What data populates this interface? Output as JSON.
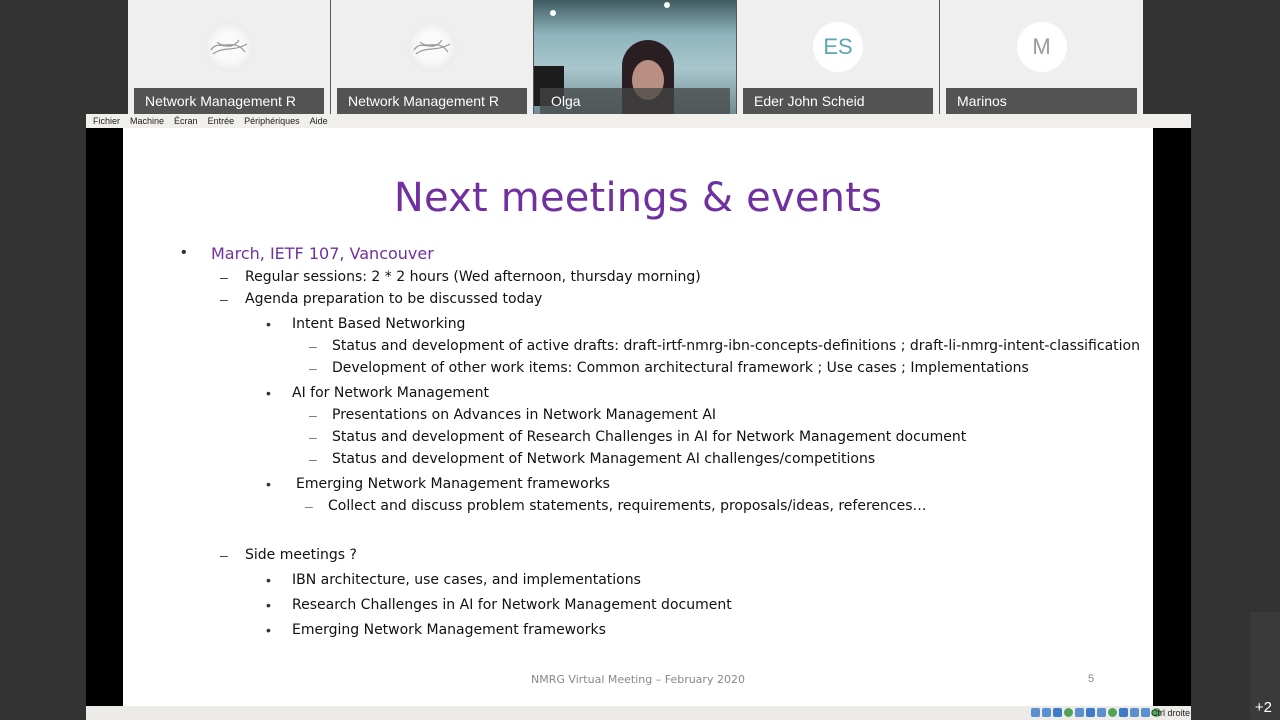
{
  "participants": [
    {
      "name": "Network Management R",
      "avatar_type": "image",
      "avatar_icon": "network-graph-icon"
    },
    {
      "name": "Network Management R",
      "avatar_type": "image",
      "avatar_icon": "network-graph-icon"
    },
    {
      "name": "Olga",
      "avatar_type": "video"
    },
    {
      "name": "Eder John Scheid",
      "avatar_type": "initials",
      "initials": "ES",
      "initials_color": "#5aa7b3"
    },
    {
      "name": "Marinos",
      "avatar_type": "initials",
      "initials": "M",
      "initials_color": "#9a9a9a"
    }
  ],
  "vm_menu": [
    "Fichier",
    "Machine",
    "Écran",
    "Entrée",
    "Périphériques",
    "Aide"
  ],
  "slide": {
    "title": "Next meetings & events",
    "title_color": "#7030a0",
    "items": [
      {
        "level": 1,
        "marker": "•",
        "text": "March, IETF 107, Vancouver"
      },
      {
        "level": 2,
        "marker": "–",
        "text": "Regular sessions: 2 * 2 hours (Wed afternoon, thursday morning)"
      },
      {
        "level": 2,
        "marker": "–",
        "text": "Agenda preparation to be discussed today"
      },
      {
        "level": 3,
        "marker": "•",
        "text": "Intent Based Networking"
      },
      {
        "level": 4,
        "marker": "–",
        "text": "Status and development of active drafts: draft-irtf-nmrg-ibn-concepts-definitions ; draft-li-nmrg-intent-classification"
      },
      {
        "level": 4,
        "marker": "–",
        "text": "Development of other work items: Common architectural framework ; Use cases ; Implementations"
      },
      {
        "level": 3,
        "marker": "•",
        "text": "AI for Network Management"
      },
      {
        "level": 4,
        "marker": "–",
        "text": "Presentations on Advances in Network Management AI"
      },
      {
        "level": 4,
        "marker": "–",
        "text": "Status and development of Research Challenges in AI for Network Management document"
      },
      {
        "level": 4,
        "marker": "–",
        "text": "Status and development of Network Management AI challenges/competitions"
      },
      {
        "level": 3,
        "marker": "•",
        "text": "Emerging Network Management frameworks"
      },
      {
        "level": 4,
        "marker": "–",
        "text": "Collect and discuss problem statements, requirements, proposals/ideas, references…"
      },
      {
        "level": 2,
        "marker": "–",
        "text": "Side meetings ?"
      },
      {
        "level": 3,
        "marker": "•",
        "text": "IBN architecture, use cases, and implementations"
      },
      {
        "level": 3,
        "marker": "•",
        "text": "Research Challenges in AI for Network Management document"
      },
      {
        "level": 3,
        "marker": "•",
        "text": "Emerging Network Management frameworks"
      }
    ],
    "footer": "NMRG Virtual Meeting – February 2020",
    "page_number": "5"
  },
  "vm_status": {
    "host_key": "Ctrl droite"
  },
  "more_participants": "+2"
}
